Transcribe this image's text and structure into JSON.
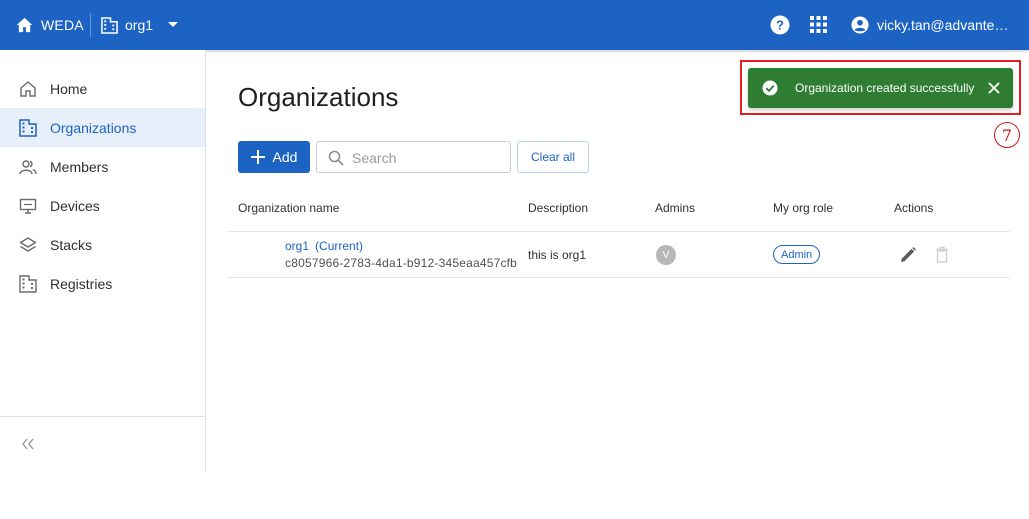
{
  "header": {
    "brand_label": "WEDA",
    "org_label": "org1",
    "user_email": "vicky.tan@advantech.com"
  },
  "sidebar": {
    "items": [
      {
        "label": "Home",
        "icon": "home-icon"
      },
      {
        "label": "Organizations",
        "icon": "organizations-icon",
        "active": true
      },
      {
        "label": "Members",
        "icon": "members-icon"
      },
      {
        "label": "Devices",
        "icon": "devices-icon"
      },
      {
        "label": "Stacks",
        "icon": "stacks-icon"
      },
      {
        "label": "Registries",
        "icon": "registries-icon"
      }
    ],
    "collapse_icon": "double-chevron-left-icon"
  },
  "main": {
    "title": "Organizations",
    "add_label": "Add",
    "search_placeholder": "Search",
    "clear_label": "Clear all"
  },
  "table": {
    "columns": [
      "Organization name",
      "Description",
      "Admins",
      "My org role",
      "Actions"
    ],
    "rows": [
      {
        "name": "org1",
        "current_tag": "(Current)",
        "id": "c8057966-2783-4da1-b912-345eaa457cfb",
        "description": "this is org1",
        "admin_initial": "V",
        "role": "Admin"
      }
    ]
  },
  "toast": {
    "message": "Organization created successfully",
    "step_number": "7"
  },
  "colors": {
    "primary": "#1d63c4",
    "toast_success": "#2e7d32",
    "highlight": "#e01e1e"
  }
}
